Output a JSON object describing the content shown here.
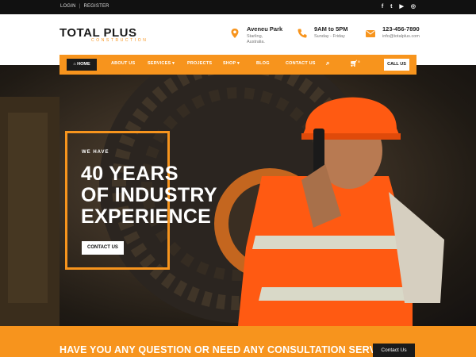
{
  "topbar": {
    "login": "LOGIN",
    "separator": "|",
    "register": "REGISTER",
    "social": [
      {
        "name": "facebook-icon",
        "glyph": "f"
      },
      {
        "name": "twitter-icon",
        "glyph": "t"
      },
      {
        "name": "youtube-icon",
        "glyph": "▶"
      },
      {
        "name": "instagram-icon",
        "glyph": "◎"
      }
    ]
  },
  "logo": {
    "main": "TOTAL PLUS",
    "sub": "CONSTRUCTION"
  },
  "contact": {
    "address_title": "Aveneu Park",
    "address_line": "Starling, Australia.",
    "hours_title": "9AM to 5PM",
    "hours_line": "Sunday - Friday",
    "phone_title": "123-456-7890",
    "email": "info@totalplus.com"
  },
  "nav": {
    "home": "HOME",
    "items": [
      "ABOUT US",
      "SERVICES",
      "PROJECTS",
      "SHOP",
      "BLOG",
      "CONTACT US"
    ],
    "cart_count": "0",
    "call": "CALL US"
  },
  "hero": {
    "kicker": "WE HAVE",
    "title_line1": "40 YEARS",
    "title_line2": "OF INDUSTRY",
    "title_line3": "EXPERIENCE",
    "button": "CONTACT US"
  },
  "cta": {
    "text": "HAVE YOU ANY QUESTION OR NEED ANY CONSULTATION SERVICE!",
    "button": "Contact Us"
  },
  "colors": {
    "accent": "#f7941d",
    "dark": "#1b1b1b",
    "topbar": "#111111"
  }
}
